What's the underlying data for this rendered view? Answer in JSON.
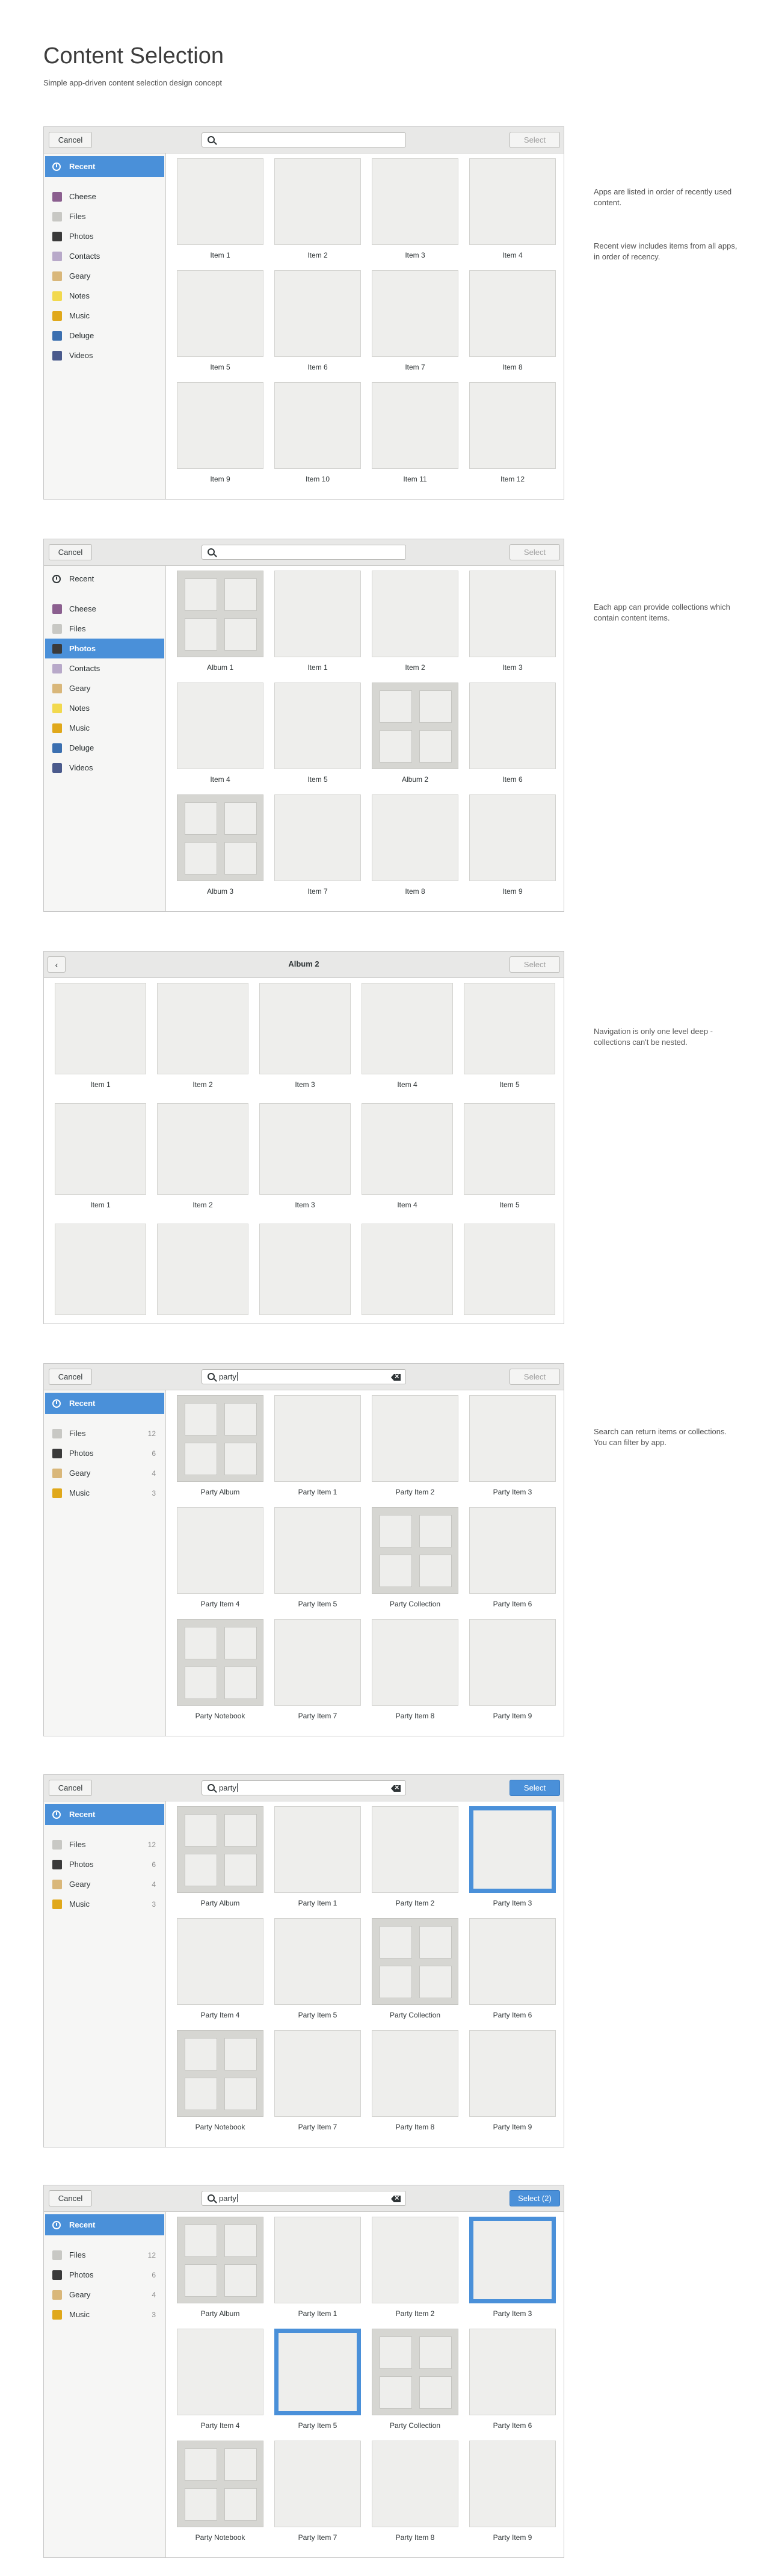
{
  "page": {
    "title": "Content Selection",
    "subtitle": "Simple app-driven content selection design concept"
  },
  "labels": {
    "cancel": "Cancel",
    "select": "Select",
    "select_count": "Select (2)",
    "back": "‹"
  },
  "search": {
    "query": "party"
  },
  "notes": {
    "n1": "Apps are listed in order of recently used content.",
    "n2": "Recent view includes items from all apps, in order of recency.",
    "n3": "Each app can provide collections which contain content items.",
    "n4": "Navigation is only one level deep - collections can't be nested.",
    "n5": "Search can return items or collections. You can filter by app."
  },
  "sidebar_all": [
    {
      "label": "Recent",
      "icon": "clock-icon"
    },
    {
      "label": "Cheese",
      "icon": "cheese-icon",
      "color": "#8b5f8f"
    },
    {
      "label": "Files",
      "icon": "files-icon",
      "color": "#c8c8c4"
    },
    {
      "label": "Photos",
      "icon": "photos-icon",
      "color": "#3a3a3a"
    },
    {
      "label": "Contacts",
      "icon": "contacts-icon",
      "color": "#b8a9c9"
    },
    {
      "label": "Geary",
      "icon": "geary-icon",
      "color": "#d9b77a"
    },
    {
      "label": "Notes",
      "icon": "notes-icon",
      "color": "#f2d94e"
    },
    {
      "label": "Music",
      "icon": "music-icon",
      "color": "#e0a81a"
    },
    {
      "label": "Deluge",
      "icon": "deluge-icon",
      "color": "#3b6fb0"
    },
    {
      "label": "Videos",
      "icon": "videos-icon",
      "color": "#4a5a8c"
    }
  ],
  "sidebar_search": [
    {
      "label": "Recent",
      "icon": "clock-icon"
    },
    {
      "label": "Files",
      "icon": "files-icon",
      "color": "#c8c8c4",
      "count": "12"
    },
    {
      "label": "Photos",
      "icon": "photos-icon",
      "color": "#3a3a3a",
      "count": "6"
    },
    {
      "label": "Geary",
      "icon": "geary-icon",
      "color": "#d9b77a",
      "count": "4"
    },
    {
      "label": "Music",
      "icon": "music-icon",
      "color": "#e0a81a",
      "count": "3"
    }
  ],
  "grid1": [
    "Item 1",
    "Item 2",
    "Item 3",
    "Item 4",
    "Item 5",
    "Item 6",
    "Item 7",
    "Item 8",
    "Item 9",
    "Item 10",
    "Item 11",
    "Item 12"
  ],
  "grid2": [
    {
      "label": "Album 1",
      "collection": true
    },
    {
      "label": "Item 1"
    },
    {
      "label": "Item 2"
    },
    {
      "label": "Item 3"
    },
    {
      "label": "Item 4"
    },
    {
      "label": "Item 5"
    },
    {
      "label": "Album 2",
      "collection": true
    },
    {
      "label": "Item 6"
    },
    {
      "label": "Album 3",
      "collection": true
    },
    {
      "label": "Item 7"
    },
    {
      "label": "Item 8"
    },
    {
      "label": "Item 9"
    }
  ],
  "album": {
    "title": "Album 2",
    "items": [
      "Item 1",
      "Item 2",
      "Item 3",
      "Item 4",
      "Item 5",
      "Item 1",
      "Item 2",
      "Item 3",
      "Item 4",
      "Item 5",
      "",
      "",
      "",
      "",
      ""
    ]
  },
  "grid_search": [
    {
      "label": "Party Album",
      "collection": true
    },
    {
      "label": "Party Item 1"
    },
    {
      "label": "Party Item 2"
    },
    {
      "label": "Party Item 3"
    },
    {
      "label": "Party Item 4"
    },
    {
      "label": "Party Item 5"
    },
    {
      "label": "Party Collection",
      "collection": true
    },
    {
      "label": "Party Item 6"
    },
    {
      "label": "Party Notebook",
      "collection": true
    },
    {
      "label": "Party Item 7"
    },
    {
      "label": "Party Item 8"
    },
    {
      "label": "Party Item 9"
    }
  ],
  "selected_m5": [
    "Party Item 3"
  ],
  "selected_m6": [
    "Party Item 3",
    "Party Item 5"
  ]
}
